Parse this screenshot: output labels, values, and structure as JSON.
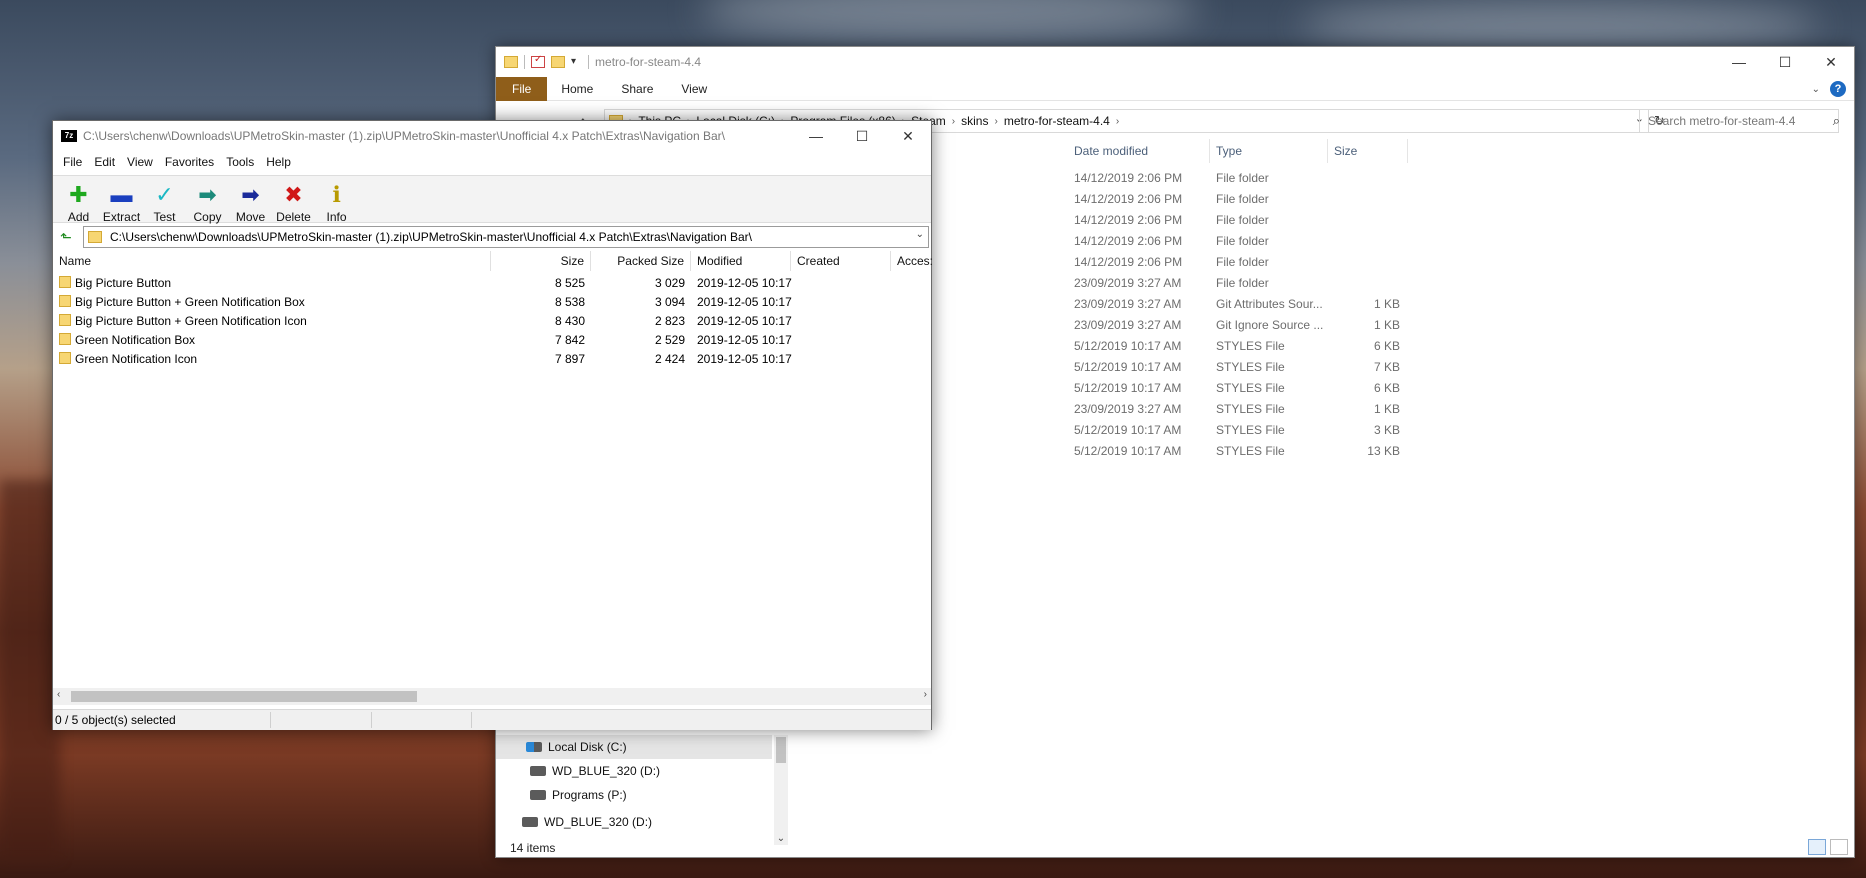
{
  "explorer": {
    "title": "metro-for-steam-4.4",
    "ribbon_tabs": [
      "File",
      "Home",
      "Share",
      "View"
    ],
    "breadcrumbs": [
      "This PC",
      "Local Disk (C:)",
      "Program Files (x86)",
      "Steam",
      "skins",
      "metro-for-steam-4.4"
    ],
    "search_placeholder": "Search metro-for-steam-4.4",
    "columns": {
      "date": "Date modified",
      "type": "Type",
      "size": "Size"
    },
    "rows": [
      {
        "date": "14/12/2019 2:06 PM",
        "type": "File folder",
        "size": ""
      },
      {
        "date": "14/12/2019 2:06 PM",
        "type": "File folder",
        "size": ""
      },
      {
        "date": "14/12/2019 2:06 PM",
        "type": "File folder",
        "size": ""
      },
      {
        "date": "14/12/2019 2:06 PM",
        "type": "File folder",
        "size": ""
      },
      {
        "date": "14/12/2019 2:06 PM",
        "type": "File folder",
        "size": ""
      },
      {
        "date": "23/09/2019 3:27 AM",
        "type": "File folder",
        "size": ""
      },
      {
        "date": "23/09/2019 3:27 AM",
        "type": "Git Attributes Sour...",
        "size": "1 KB"
      },
      {
        "date": "23/09/2019 3:27 AM",
        "type": "Git Ignore Source ...",
        "size": "1 KB"
      },
      {
        "date": "5/12/2019 10:17 AM",
        "type": "STYLES File",
        "size": "6 KB"
      },
      {
        "date": "5/12/2019 10:17 AM",
        "type": "STYLES File",
        "size": "7 KB"
      },
      {
        "date": "5/12/2019 10:17 AM",
        "type": "STYLES File",
        "size": "6 KB"
      },
      {
        "date": "23/09/2019 3:27 AM",
        "type": "STYLES File",
        "size": "1 KB"
      },
      {
        "date": "5/12/2019 10:17 AM",
        "type": "STYLES File",
        "size": "3 KB"
      },
      {
        "date": "5/12/2019 10:17 AM",
        "type": "STYLES File",
        "size": "13 KB"
      }
    ],
    "tree": [
      "Local Disk (C:)",
      "WD_BLUE_320 (D:)",
      "Programs (P:)",
      "WD_BLUE_320 (D:)"
    ],
    "status": "14 items"
  },
  "sevenzip": {
    "title": "C:\\Users\\chenw\\Downloads\\UPMetroSkin-master (1).zip\\UPMetroSkin-master\\Unofficial 4.x Patch\\Extras\\Navigation Bar\\",
    "logo": "7z",
    "menus": [
      "File",
      "Edit",
      "View",
      "Favorites",
      "Tools",
      "Help"
    ],
    "toolbar": [
      {
        "label": "Add",
        "icon": "add-icon"
      },
      {
        "label": "Extract",
        "icon": "extract-icon"
      },
      {
        "label": "Test",
        "icon": "test-icon"
      },
      {
        "label": "Copy",
        "icon": "copy-icon"
      },
      {
        "label": "Move",
        "icon": "move-icon"
      },
      {
        "label": "Delete",
        "icon": "delete-icon"
      },
      {
        "label": "Info",
        "icon": "info-icon"
      }
    ],
    "path": "C:\\Users\\chenw\\Downloads\\UPMetroSkin-master (1).zip\\UPMetroSkin-master\\Unofficial 4.x Patch\\Extras\\Navigation Bar\\",
    "columns": {
      "name": "Name",
      "size": "Size",
      "packed": "Packed Size",
      "modified": "Modified",
      "created": "Created",
      "accessed": "Acces:"
    },
    "rows": [
      {
        "name": "Big Picture Button",
        "size": "8 525",
        "packed": "3 029",
        "modified": "2019-12-05 10:17"
      },
      {
        "name": "Big Picture Button + Green Notification Box",
        "size": "8 538",
        "packed": "3 094",
        "modified": "2019-12-05 10:17"
      },
      {
        "name": "Big Picture Button + Green Notification Icon",
        "size": "8 430",
        "packed": "2 823",
        "modified": "2019-12-05 10:17"
      },
      {
        "name": "Green Notification Box",
        "size": "7 842",
        "packed": "2 529",
        "modified": "2019-12-05 10:17"
      },
      {
        "name": "Green Notification Icon",
        "size": "7 897",
        "packed": "2 424",
        "modified": "2019-12-05 10:17"
      }
    ],
    "status": "0 / 5 object(s) selected"
  }
}
